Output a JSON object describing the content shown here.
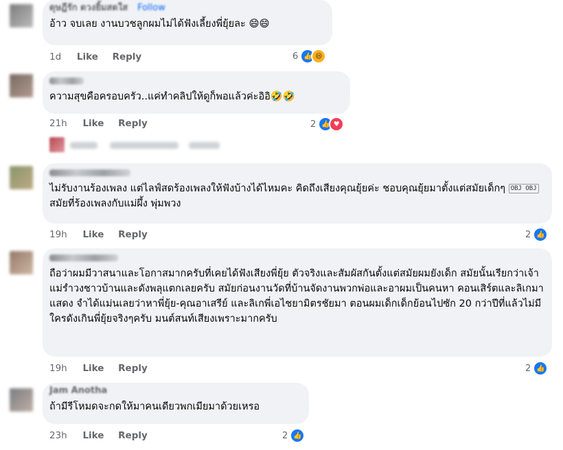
{
  "comments": [
    {
      "name_blurred": "ดุษฎีรัก ดวงยิ้มสดใส",
      "follow_label": "Follow",
      "text": "อ้าว จบเลย งานบวชลูกผมไม่ได้ฟังเลี้ยงพี่ยุ้ยละ 😄😄",
      "time": "1d",
      "like_label": "Like",
      "reply_label": "Reply",
      "reaction_count": "6",
      "reactions": [
        "like-icon",
        "haha-icon"
      ]
    },
    {
      "text": "ความสุขคือครอบครัว..แค่ทำคลิปให้ดูก็พอแล้วค่ะอิอิ🤣🤣",
      "time": "21h",
      "like_label": "Like",
      "reply_label": "Reply",
      "reaction_count": "2",
      "reactions": [
        "like-icon",
        "heart-icon"
      ]
    },
    {
      "text_before": "ไม่รับงานร้องเพลง แต่ไลฟ์สดร้องเพลงให้ฟังบ้างได้ไหมคะ คิดถึงเสียงคุณยุ้ยค่ะ ชอบคุณยุ้ยมาตั้งแต่สมัยเด็กๆ ",
      "chip": "OBJ OBJ",
      "text_after": "สมัยที่ร้องเพลงกับแม่ผึ้ง พุ่มพวง",
      "time": "19h",
      "like_label": "Like",
      "reply_label": "Reply",
      "reaction_count": "2",
      "reactions": [
        "like-icon"
      ]
    },
    {
      "text": "ถือว่าผมมีวาสนาและโอกาสมากครับที่เคยได้ฟังเสียงพี่ยุ้ย ตัวจริงและสัมผัสกันตั้งแต่สมัยผมยังเด็ก สมัยนั้นเรียกว่าเจ้าแม่รำวงชาวบ้านและดังพลุแตกเลยครับ สมัยก่อนงานวัดที่บ้านจัดงานพวกพ่อและอาผมเป็นคนหา คอนเสิร์ตและลิเกมาแสดง จำได้แม่นเลยว่าหาพี่ยุ้ย-คุณอาเสรีย์ และลิเกพี่เอไชยามิตรชัยมา ตอนผมเด็กเด็กย้อนไปซัก 20 กว่าปีที่แล้วไม่มีใครดังเกินพี่ยุ้ยจริงๆครับ มนต์สนท์เสียงเพราะมากครับ",
      "time": "19h",
      "like_label": "Like",
      "reply_label": "Reply",
      "reaction_count": "2",
      "reactions": [
        "like-icon"
      ]
    },
    {
      "name_blurred": "Jam Anotha",
      "text": "ถ้ามีรีโหมดจะกดให้มาคนเดียวพกเมียมาด้วยเหรอ",
      "time": "23h",
      "like_label": "Like",
      "reply_label": "Reply",
      "reaction_count": "2",
      "reactions": [
        "like-icon"
      ]
    }
  ],
  "colors": {
    "bubble": "#f0f2f5",
    "meta": "#65676b",
    "like": "#1877f2",
    "follow": "#0866ff"
  }
}
